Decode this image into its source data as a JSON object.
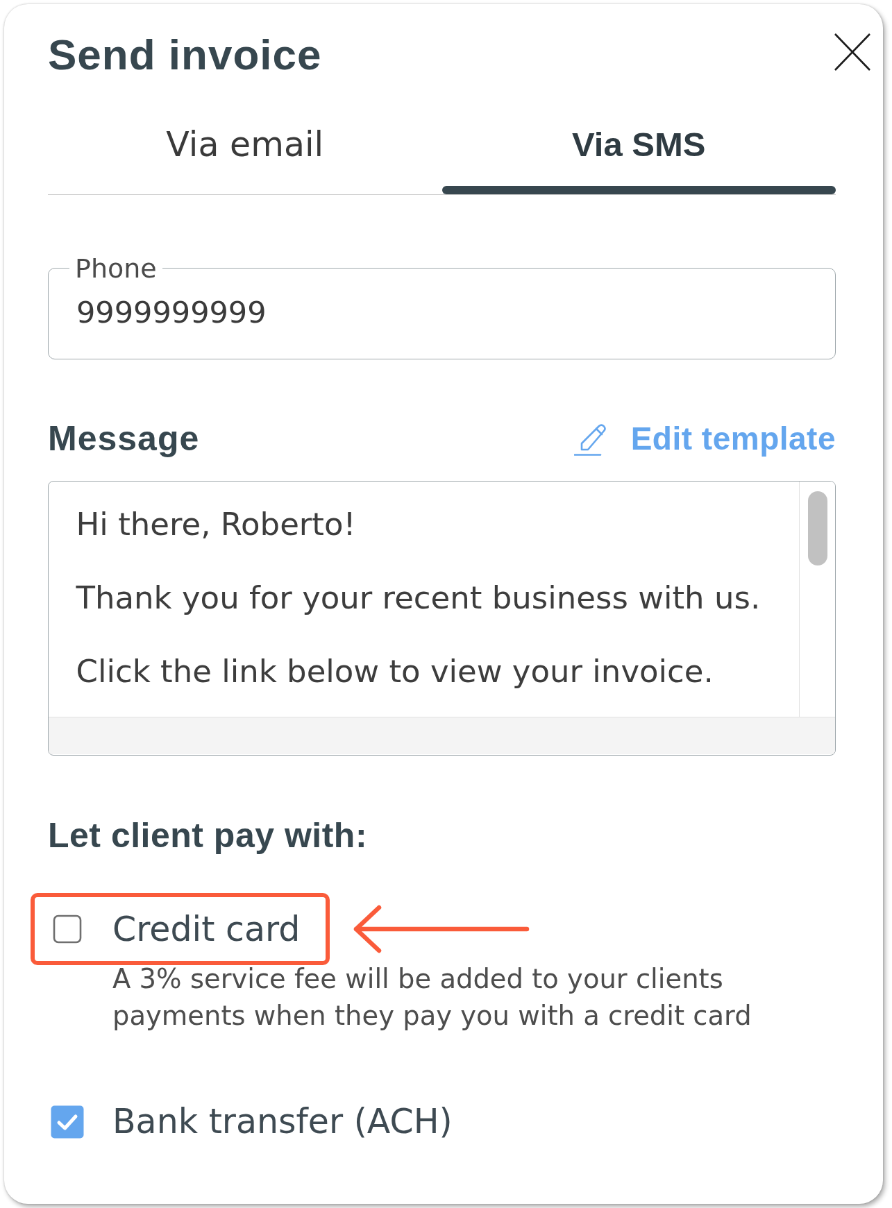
{
  "dialog": {
    "title": "Send invoice"
  },
  "tabs": [
    {
      "label": "Via email",
      "selected": false
    },
    {
      "label": "Via SMS",
      "selected": true
    }
  ],
  "phone_field": {
    "label": "Phone",
    "value": "9999999999"
  },
  "message": {
    "heading": "Message",
    "edit_link": "Edit template",
    "paragraphs": [
      "Hi there, Roberto!",
      "Thank you for your recent business with us.",
      "Click the link below to view your invoice."
    ]
  },
  "payment": {
    "heading": "Let client pay with:",
    "options": [
      {
        "label": "Credit card",
        "checked": false,
        "highlighted": true,
        "note": "A 3% service fee will be added to your clients payments when they pay you with a credit card"
      },
      {
        "label": "Bank transfer (ACH)",
        "checked": true,
        "highlighted": false
      }
    ]
  }
}
